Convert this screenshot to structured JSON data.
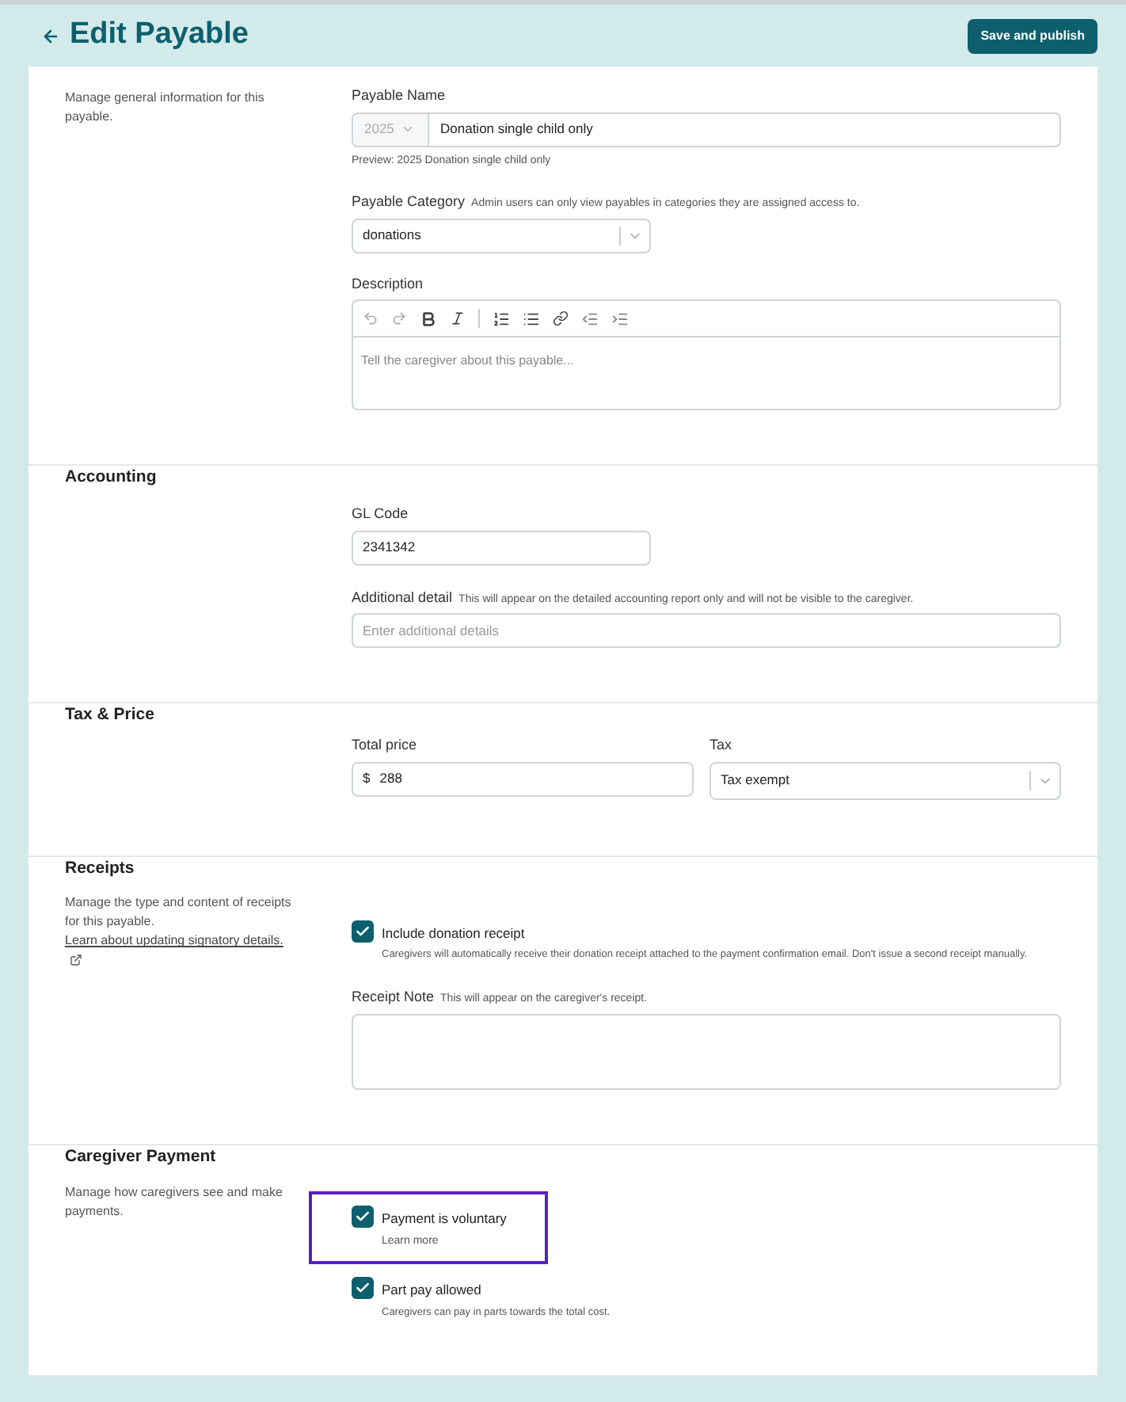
{
  "header": {
    "title": "Edit Payable",
    "primary_button": "Save and publish"
  },
  "general": {
    "description": "Manage general information for this payable.",
    "name_label": "Payable Name",
    "year": "2025",
    "name_value": "Donation single child only",
    "preview": "Preview: 2025 Donation single child only",
    "category_label": "Payable Category",
    "category_hint": "Admin users can only view payables in categories they are assigned access to.",
    "category_value": "donations",
    "description_label": "Description",
    "description_placeholder": "Tell the caregiver about this payable..."
  },
  "accounting": {
    "title": "Accounting",
    "gl_label": "GL Code",
    "gl_value": "2341342",
    "detail_label": "Additional detail",
    "detail_hint": "This will appear on the detailed accounting report only and will not be visible to the caregiver.",
    "detail_placeholder": "Enter additional details"
  },
  "tax_price": {
    "title": "Tax & Price",
    "price_label": "Total price",
    "currency": "$",
    "price_value": "288",
    "tax_label": "Tax",
    "tax_value": "Tax exempt"
  },
  "receipts": {
    "title": "Receipts",
    "description": "Manage the type and content of receipts for this payable.",
    "link": "Learn about updating signatory details.",
    "checkbox": {
      "label": "Include donation receipt",
      "help": "Caregivers will automatically receive their donation receipt attached to the payment confirmation email. Don't issue a second receipt manually.",
      "checked": true
    },
    "note_label": "Receipt Note",
    "note_hint": "This will appear on the caregiver's receipt."
  },
  "caregiver_payment": {
    "title": "Caregiver Payment",
    "description": "Manage how caregivers see and make payments.",
    "options": [
      {
        "label": "Payment is voluntary",
        "help": "Learn more",
        "kind": "link",
        "checked": true,
        "highlighted": true
      },
      {
        "label": "Part pay allowed",
        "help": "Caregivers can pay in parts towards the total cost.",
        "kind": "text",
        "checked": true,
        "highlighted": false
      }
    ]
  }
}
